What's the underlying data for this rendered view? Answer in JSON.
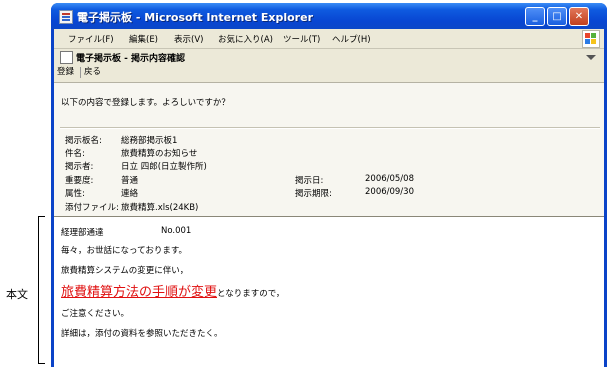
{
  "annotation": {
    "label": "本文"
  },
  "window": {
    "title": "電子掲示板 - Microsoft Internet Explorer"
  },
  "menubar": {
    "items": [
      "ファイル(F)",
      "編集(E)",
      "表示(V)",
      "お気に入り(A)",
      "ツール(T)",
      "ヘルプ(H)"
    ]
  },
  "frame": {
    "title": "電子掲示板 - 掲示内容確認"
  },
  "toolbar": {
    "register": "登録",
    "back": "戻る"
  },
  "confirm_message": "以下の内容で登録します。よろしいですか？",
  "fields": {
    "board_label": "掲示板名:",
    "board_value": "総務部掲示板1",
    "subject_label": "件名:",
    "subject_value": "旅費精算のお知らせ",
    "poster_label": "掲示者:",
    "poster_value": "日立 四郎(日立製作所)",
    "importance_label": "重要度:",
    "importance_value": "普通",
    "attribute_label": "属性:",
    "attribute_value": "連絡",
    "attachment_label": "添付ファイル:",
    "attachment_value": "旅費精算.xls(24KB)",
    "post_date_label": "掲示日:",
    "post_date_value": "2006/05/08",
    "deadline_label": "掲示期限:",
    "deadline_value": "2006/09/30"
  },
  "body": {
    "line1": "経理部通達",
    "line1_num": "No.001",
    "line2": "毎々，お世話になっております。",
    "line3": "旅費精算システムの変更に伴い，",
    "line4_highlight": "旅費精算方法の手順が変更",
    "line4_rest": "となりますので，",
    "line5": "ご注意ください。",
    "line6": "詳細は，添付の資料を参照いただきたく。"
  },
  "colors": {
    "highlight": "#e01010",
    "titlebar": "#0846d2",
    "chrome": "#ece9d8"
  },
  "icons": [
    "board-icon",
    "minimize-icon",
    "maximize-icon",
    "close-icon",
    "windows-logo-icon",
    "page-icon",
    "dropdown-arrow-icon"
  ]
}
